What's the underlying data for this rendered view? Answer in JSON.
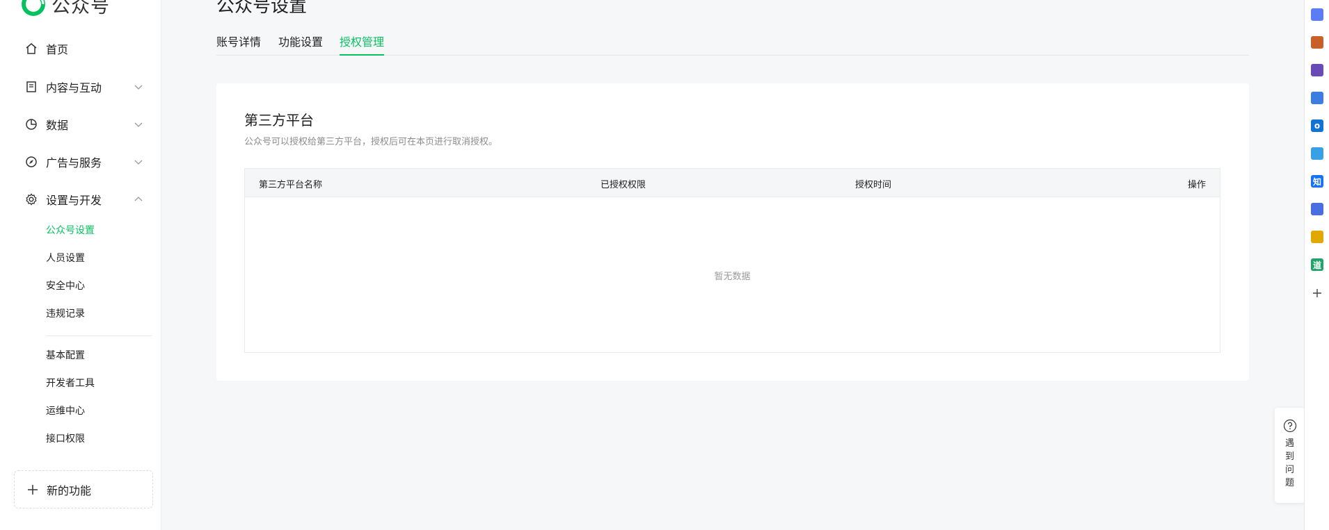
{
  "app": {
    "logo_text": "公众号"
  },
  "sidebar": {
    "items": [
      {
        "label": "首页"
      },
      {
        "label": "内容与互动"
      },
      {
        "label": "数据"
      },
      {
        "label": "广告与服务"
      },
      {
        "label": "设置与开发"
      }
    ],
    "sub_items": [
      {
        "label": "公众号设置",
        "active": true
      },
      {
        "label": "人员设置"
      },
      {
        "label": "安全中心"
      },
      {
        "label": "违规记录"
      },
      {
        "label": "基本配置"
      },
      {
        "label": "开发者工具"
      },
      {
        "label": "运维中心"
      },
      {
        "label": "接口权限"
      }
    ],
    "new_feature_label": "新的功能"
  },
  "main": {
    "page_title": "公众号设置",
    "tabs": [
      {
        "label": "账号详情"
      },
      {
        "label": "功能设置"
      },
      {
        "label": "授权管理",
        "active": true
      }
    ],
    "card": {
      "title": "第三方平台",
      "description": "公众号可以授权给第三方平台，授权后可在本页进行取消授权。",
      "table": {
        "columns": [
          "第三方平台名称",
          "已授权权限",
          "授权时间",
          "操作"
        ],
        "rows": [],
        "empty_text": "暂无数据"
      }
    }
  },
  "help": {
    "label": "遇到问题"
  },
  "rail": {
    "icons": [
      {
        "name": "tag-icon",
        "color": "#5b7cf5",
        "glyph": ""
      },
      {
        "name": "briefcase-icon",
        "color": "#c8602a",
        "glyph": ""
      },
      {
        "name": "user-tool-icon",
        "color": "#6a4bb5",
        "glyph": ""
      },
      {
        "name": "copilot-icon",
        "color": "#3d7de0",
        "glyph": ""
      },
      {
        "name": "outlook-icon",
        "color": "#1173d4",
        "glyph": "o"
      },
      {
        "name": "send-icon",
        "color": "#3aa0e6",
        "glyph": ""
      },
      {
        "name": "zhihu-icon",
        "color": "#1772f6",
        "glyph": "知"
      },
      {
        "name": "bowtie-icon",
        "color": "#4a6ee0",
        "glyph": ""
      },
      {
        "name": "pencil-icon",
        "color": "#e0a800",
        "glyph": ""
      },
      {
        "name": "youdao-icon",
        "color": "#22a36a",
        "glyph": "道"
      }
    ]
  },
  "colors": {
    "accent": "#07c160",
    "text": "#1f1f1f",
    "muted": "#8c8c8c",
    "bg": "#f6f7f8"
  }
}
